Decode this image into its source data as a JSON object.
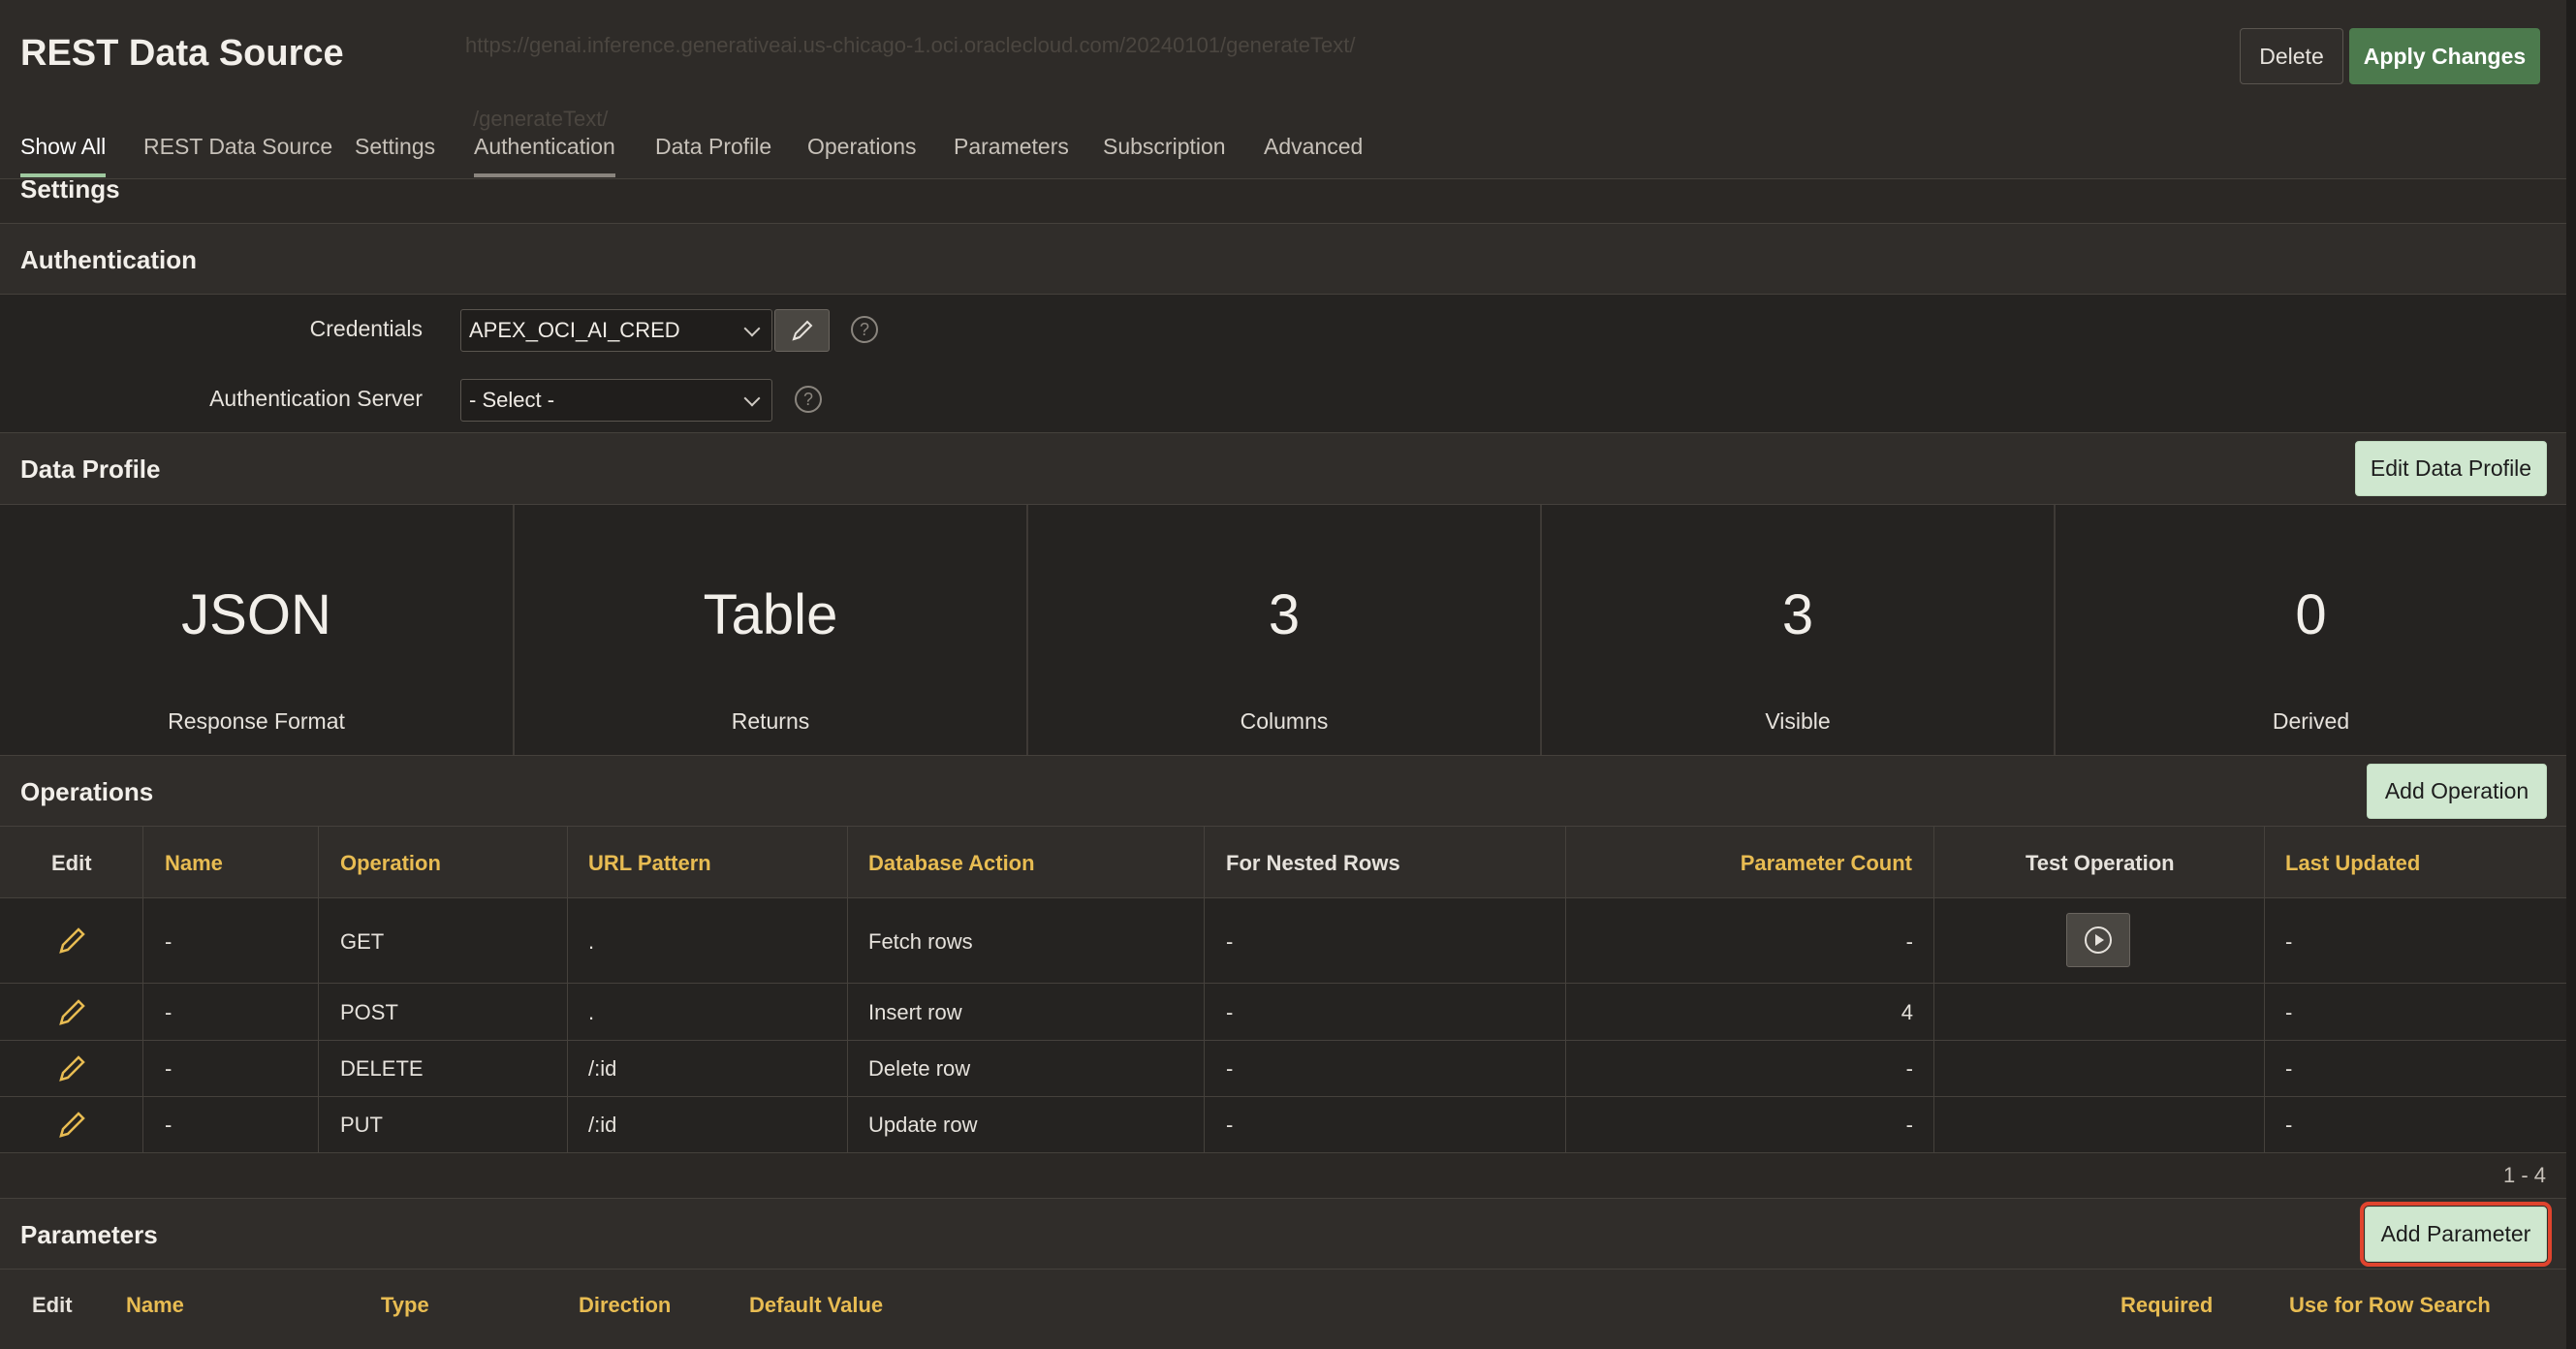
{
  "header": {
    "title": "REST Data Source",
    "ghost_url": "https://genai.inference.generativeai.us-chicago-1.oci.oraclecloud.com/20240101/generateText/",
    "ghost_path": "/generateText/",
    "delete_label": "Delete",
    "apply_label": "Apply Changes"
  },
  "tabs": [
    {
      "label": "Show All"
    },
    {
      "label": "REST Data Source"
    },
    {
      "label": "Settings"
    },
    {
      "label": "Authentication"
    },
    {
      "label": "Data Profile"
    },
    {
      "label": "Operations"
    },
    {
      "label": "Parameters"
    },
    {
      "label": "Subscription"
    },
    {
      "label": "Advanced"
    }
  ],
  "settings_peek": "Settings",
  "authentication": {
    "title": "Authentication",
    "credentials_label": "Credentials",
    "credentials_value": "APEX_OCI_AI_CRED",
    "auth_server_label": "Authentication Server",
    "auth_server_value": "- Select -",
    "help_glyph": "?"
  },
  "data_profile": {
    "title": "Data Profile",
    "edit_label": "Edit Data Profile",
    "stats": [
      {
        "value": "JSON",
        "label": "Response Format"
      },
      {
        "value": "Table",
        "label": "Returns"
      },
      {
        "value": "3",
        "label": "Columns"
      },
      {
        "value": "3",
        "label": "Visible"
      },
      {
        "value": "0",
        "label": "Derived"
      }
    ]
  },
  "operations": {
    "title": "Operations",
    "add_label": "Add Operation",
    "columns": [
      "Edit",
      "Name",
      "Operation",
      "URL Pattern",
      "Database Action",
      "For Nested Rows",
      "Parameter Count",
      "Test Operation",
      "Last Updated"
    ],
    "rows": [
      {
        "name": "-",
        "operation": "GET",
        "url": ".",
        "action": "Fetch rows",
        "nested": "-",
        "count": "-",
        "updated": "-"
      },
      {
        "name": "-",
        "operation": "POST",
        "url": ".",
        "action": "Insert row",
        "nested": "-",
        "count": "4",
        "updated": "-"
      },
      {
        "name": "-",
        "operation": "DELETE",
        "url": "/:id",
        "action": "Delete row",
        "nested": "-",
        "count": "-",
        "updated": "-"
      },
      {
        "name": "-",
        "operation": "PUT",
        "url": "/:id",
        "action": "Update row",
        "nested": "-",
        "count": "-",
        "updated": "-"
      }
    ],
    "pagination": "1 - 4"
  },
  "parameters": {
    "title": "Parameters",
    "add_label": "Add Parameter",
    "columns": [
      "Edit",
      "Name",
      "Type",
      "Direction",
      "Default Value",
      "Required",
      "Use for Row Search"
    ]
  },
  "colors": {
    "background": "#2b2825",
    "accent_green": "#4c7a4d",
    "light_green": "#cfe7cf",
    "header_yellow": "#e8bc52",
    "highlight_red": "#e0442e"
  },
  "icons": [
    "pencil-icon",
    "chevron-down-icon",
    "help-icon",
    "play-circle-icon"
  ]
}
